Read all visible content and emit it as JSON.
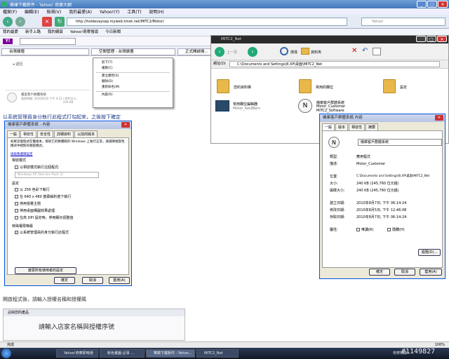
{
  "ie": {
    "title": "華庫下載新件 - Yahoo! 奇摩大網",
    "menu": [
      "檔案(F)",
      "編輯(E)",
      "檢視(V)",
      "我的最愛(A)",
      "Yahoo!(Y)",
      "工具(T)",
      "說明(H)"
    ],
    "address": "http://holdevaysep.myweb.hinet.net/MITC2/Motor/",
    "search_placeholder": "Yahoo!",
    "favorites": [
      "我的最愛",
      "新手上路",
      "我的網頁",
      "Yahoo!奇摩搜尋",
      "今日新聞"
    ],
    "tabs": [
      "台灣論壇",
      "空間管理 - 台灣論壇",
      "正式開啟換..."
    ],
    "status": "完成",
    "zoom": "100%"
  },
  "page": {
    "file_info": [
      "檔案客戶群體系統",
      "發表時間: 2010/6/10 下午 4:11 / 附件大小:",
      "224 KB"
    ],
    "instruction1": "以系統管理員身分執行此程式打勾起來，之後按下確定",
    "instruction2": "開啟程式後，請輸入授權名稱和授權碼",
    "license_panel_title": "註冊您的產品",
    "license_prompt": "請輸入店家名稱與授權序號",
    "watermark": "#1149827"
  },
  "context_menu": [
    "剪下(T)",
    "複製(C)",
    "建立捷徑(S)",
    "刪除(D)",
    "重新命名(M)",
    "內容(R)"
  ],
  "compat_dialog": {
    "title": "機庫客戶群體系統 - 內容",
    "tabs": [
      "一般",
      "相容性",
      "安全性",
      "詳細資料",
      "以前的版本"
    ],
    "intro": "如果這個程式在舊版本，那從它的軟體較的 Windows 上執行正常，請選擇相容性模式中相對的相容模式。",
    "help_link": "協助我選擇設定",
    "group_compat": "相容模式",
    "checkbox_compat": "以相容模式執行這個程式:",
    "compat_select": "Windows XP (Service Pack 3)",
    "group_settings": "設定",
    "settings": [
      "以 256 色彩下執行",
      "在 640 x 480 螢幕解析度下執行",
      "停用視覺主題",
      "停用桌面構圖效果處理",
      "在高 DPI 設定時，停用顯示調整值"
    ],
    "group_privilege": "特殊權限等級",
    "privilege_checkbox": "以系統管理員的身分執行此程式",
    "all_users_button": "變更所有使用者的設定",
    "ok": "確定",
    "cancel": "取消",
    "apply": "套用(A)"
  },
  "explorer": {
    "title": "MITC2_Net",
    "address": "C:\\Documents and Settings\\8.XP\\桌面\\MITC2_Net",
    "toolbar": [
      "上一頁",
      "搜尋",
      "資料夾"
    ],
    "items": [
      {
        "name": "您的資料庫"
      },
      {
        "name": "常用的欄位"
      },
      {
        "name": "設定"
      },
      {
        "name": "常用欄位編輯器",
        "sub": "Motor_KeidBern"
      },
      {
        "name": "機庫客戶群體系統",
        "sub": "Motor_Customer",
        "sub2": "MITC2_Software"
      }
    ]
  },
  "props_dialog": {
    "title": "機庫客戶群體系統 內容",
    "tabs": [
      "一般",
      "版本",
      "相容性",
      "摘要"
    ],
    "name": "機庫客戶群體系統",
    "rows": [
      {
        "label": "類型:",
        "value": "應用程式"
      },
      {
        "label": "描述:",
        "value": "Motor_Customer"
      },
      {
        "label": "位置:",
        "value": "C:\\Documents and Settings\\8.XP\\桌面\\MITC2_Net"
      },
      {
        "label": "大小:",
        "value": "240 KB (245,760 位元組)"
      },
      {
        "label": "磁碟大小:",
        "value": "240 KB (245,760 位元組)"
      },
      {
        "label": "建立日期:",
        "value": "2010年8月7日, 下午 06:14:24"
      },
      {
        "label": "修改日期:",
        "value": "2010年8月5日, 下午 12:46:08"
      },
      {
        "label": "存取日期:",
        "value": "2010年8月7日, 下午 06:14:24"
      }
    ],
    "attr_label": "屬性:",
    "readonly": "唯讀(R)",
    "hidden": "隱藏(H)",
    "advanced": "進階(D)...",
    "ok": "確定",
    "cancel": "取消",
    "apply": "套用(A)"
  },
  "taskbar": {
    "items": [
      "Yahoo!奇摩即時通",
      "新色畫圖-記事 ...",
      "華庫下載新件 - Yahoo...",
      "MITC2_Net"
    ],
    "tray": "奇摩知識+"
  }
}
